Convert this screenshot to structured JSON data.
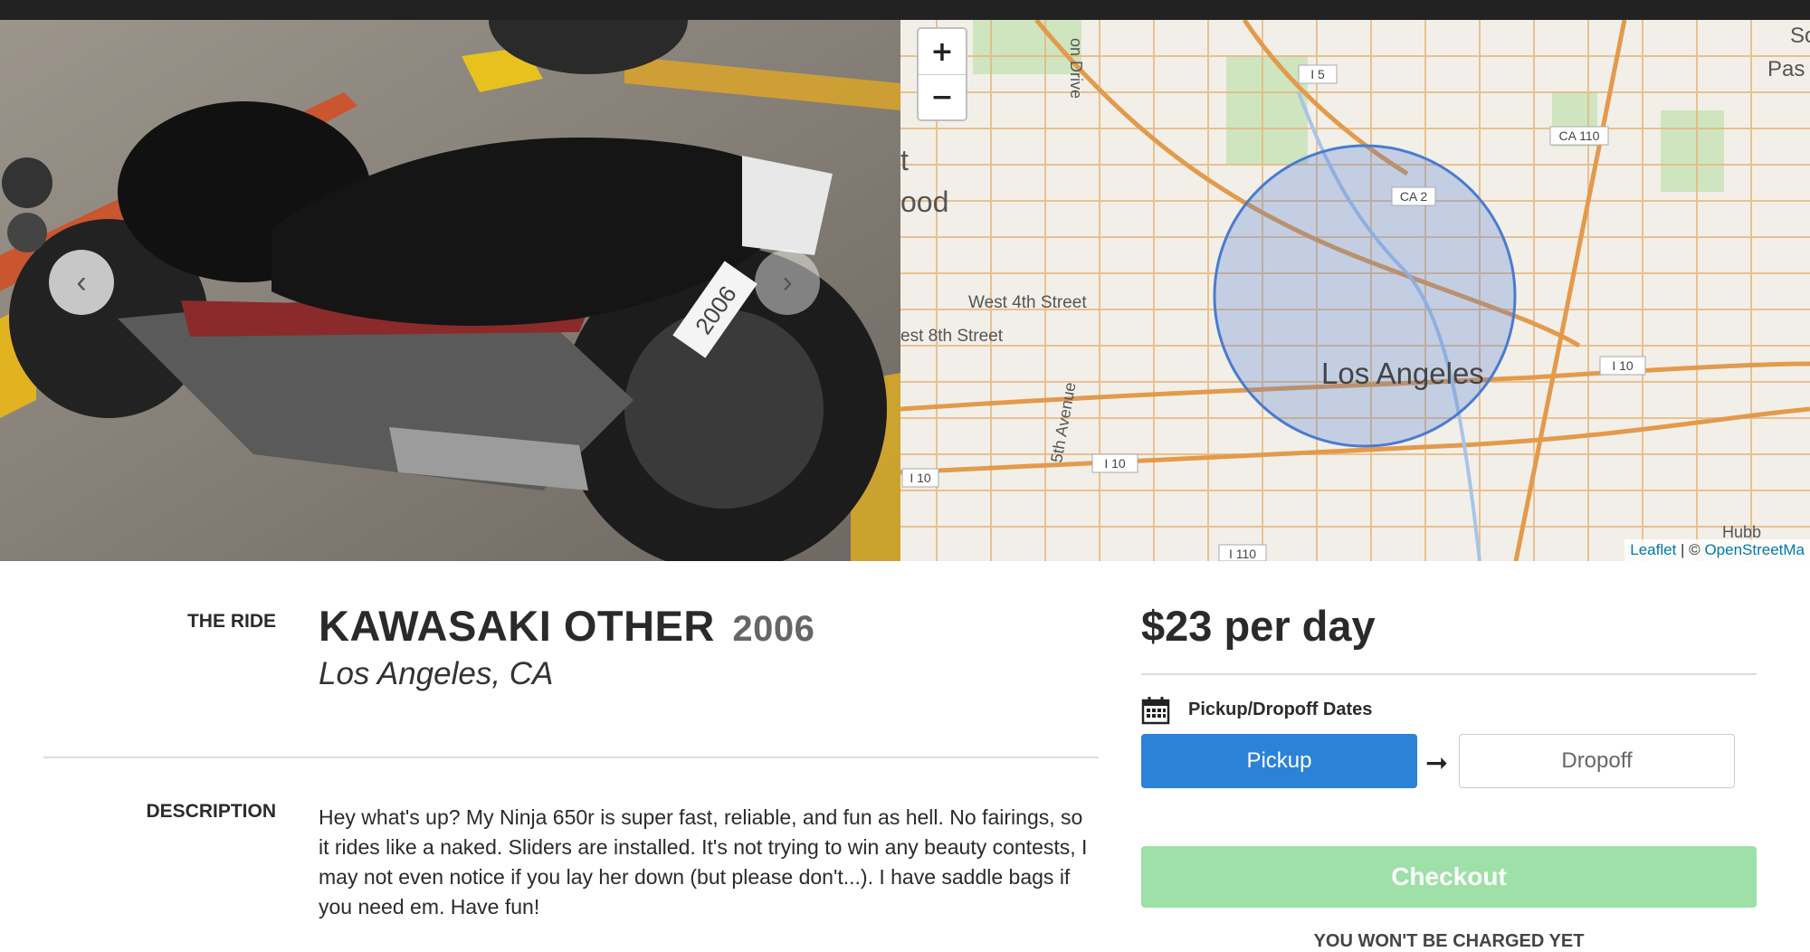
{
  "listing": {
    "section_ride": "THE RIDE",
    "make_model": "KAWASAKI OTHER",
    "year": "2006",
    "location": "Los Angeles, CA",
    "section_description": "DESCRIPTION",
    "description": "Hey what's up? My Ninja 650r is super fast, reliable, and fun as hell. No fairings, so it rides like a naked. Sliders are installed. It's not trying to win any beauty contests, I may not even notice if you lay her down (but please don't...). I have saddle bags if you need em. Have fun!"
  },
  "booking": {
    "price": "$23 per day",
    "dates_label": "Pickup/Dropoff Dates",
    "pickup_label": "Pickup",
    "arrow": "➞",
    "dropoff_label": "Dropoff",
    "checkout_label": "Checkout",
    "notice": "YOU WON'T BE CHARGED YET"
  },
  "map": {
    "zoom_in": "+",
    "zoom_out": "−",
    "attribution_leaflet": "Leaflet",
    "attribution_sep": " | © ",
    "attribution_osm": "OpenStreetMa",
    "labels": {
      "city": "Los Angeles",
      "street1": "West 4th Street",
      "street2": "est 8th Street",
      "avenue": "5th Avenue",
      "drive": "on Drive",
      "frag_t": "t",
      "frag_ood": "ood",
      "frag_so": "So",
      "frag_pas": "Pas",
      "frag_hubb": "Hubb"
    },
    "shields": [
      "I 5",
      "CA 110",
      "CA 2",
      "I 10",
      "I 10",
      "I 10",
      "I 110"
    ]
  },
  "photo": {
    "plate_text": "2006"
  },
  "colors": {
    "primary": "#2c82d6",
    "checkout_disabled": "#9ee0a7",
    "map_circle": "#4a7bd0"
  }
}
